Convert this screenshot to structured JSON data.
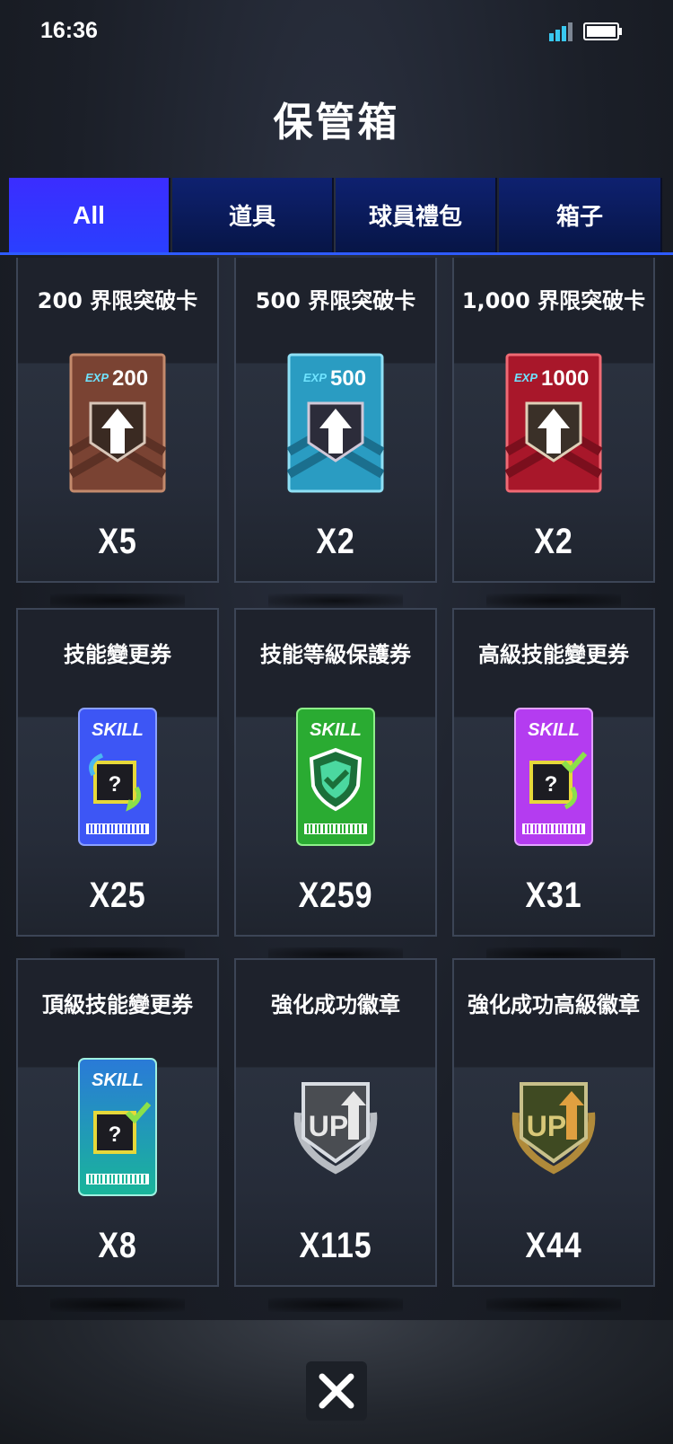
{
  "status_bar": {
    "time": "16:36",
    "signal_icon": "signal-icon",
    "battery_icon": "battery-icon"
  },
  "title": "保管箱",
  "tabs": [
    {
      "label": "All",
      "active": true
    },
    {
      "label": "道具",
      "active": false
    },
    {
      "label": "球員禮包",
      "active": false
    },
    {
      "label": "箱子",
      "active": false
    }
  ],
  "items": [
    {
      "name": "200 界限突破卡",
      "qty": "X5",
      "icon": "exp-card-bronze-icon",
      "exp_badge": "EXP",
      "exp_value": "200",
      "color": "#8a4c3a"
    },
    {
      "name": "500 界限突破卡",
      "qty": "X2",
      "icon": "exp-card-blue-icon",
      "exp_badge": "EXP",
      "exp_value": "500",
      "color": "#2aa3c9"
    },
    {
      "name": "1,000 界限突破卡",
      "qty": "X2",
      "icon": "exp-card-red-icon",
      "exp_badge": "EXP",
      "exp_value": "1000",
      "color": "#b01a26"
    },
    {
      "name": "技能變更券",
      "qty": "X25",
      "icon": "skill-ticket-blue-icon",
      "skill_label": "SKILL",
      "color": "#3f5bff"
    },
    {
      "name": "技能等級保護券",
      "qty": "X259",
      "icon": "skill-ticket-green-icon",
      "skill_label": "SKILL",
      "color": "#2fb335"
    },
    {
      "name": "高級技能變更券",
      "qty": "X31",
      "icon": "skill-ticket-purple-icon",
      "skill_label": "SKILL",
      "color": "#b43cf0"
    },
    {
      "name": "頂級技能變更券",
      "qty": "X8",
      "icon": "skill-ticket-teal-icon",
      "skill_label": "SKILL",
      "color": "#1aa8b8"
    },
    {
      "name": "強化成功徽章",
      "qty": "X115",
      "icon": "up-badge-silver-icon",
      "badge_label": "UP",
      "color": "#8a8f96"
    },
    {
      "name": "強化成功高級徽章",
      "qty": "X44",
      "icon": "up-badge-gold-icon",
      "badge_label": "UP",
      "color": "#b08a3a"
    }
  ],
  "close_button": {
    "icon": "close-icon"
  }
}
